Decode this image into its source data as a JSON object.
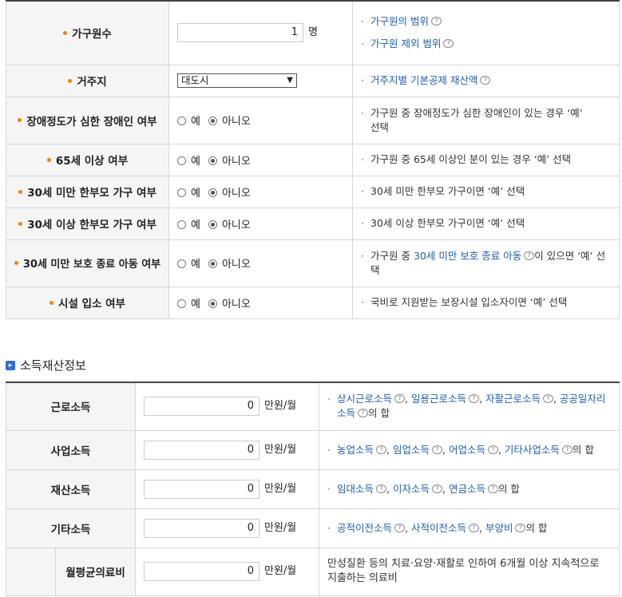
{
  "household": {
    "members": {
      "label": "가구원수",
      "value": "1",
      "unit": "명",
      "notes": [
        "가구원의 범위",
        "가구원 제외 범위"
      ]
    },
    "residence": {
      "label": "거주지",
      "value": "대도시",
      "note": "거주지별 기본공제 재산액"
    },
    "radio_yes": "예",
    "radio_no": "아니오",
    "disabled": {
      "label": "장애정도가 심한 장애인 여부",
      "note": "가구원 중 장애정도가 심한 장애인이 있는 경우 ‘예’ 선택"
    },
    "age65": {
      "label": "65세 이상 여부",
      "note": "가구원 중 65세 이상인 분이 있는 경우 ‘예’ 선택"
    },
    "single_under30": {
      "label": "30세 미만 한부모 가구 여부",
      "note": "30세 미만 한부모 가구이면 ‘예’ 선택"
    },
    "single_over30": {
      "label": "30세 이상 한부모 가구 여부",
      "note": "30세 이상 한부모 가구이면 ‘예’ 선택"
    },
    "care_end": {
      "label": "30세 미만 보호 종료 아동 여부",
      "note_pre": "가구원 중 ",
      "note_link": "30세 미만 보호 종료 아동",
      "note_post": "이 있으면 ‘예’ 선택"
    },
    "facility": {
      "label": "시설 입소 여부",
      "note": "국비로 지원받는 보장시설 입소자이면 ‘예’ 선택"
    }
  },
  "income": {
    "section_title": "소득재산정보",
    "unit": "만원/월",
    "earned": {
      "label": "근로소득",
      "value": "0",
      "links": [
        "상시근로소득",
        "일용근로소득",
        "자활근로소득",
        "공공일자리소득"
      ],
      "suffix": "의 합"
    },
    "business": {
      "label": "사업소득",
      "value": "0",
      "links": [
        "농업소득",
        "임업소득",
        "어업소득",
        "기타사업소득"
      ],
      "suffix": "의 합"
    },
    "property": {
      "label": "재산소득",
      "value": "0",
      "links": [
        "임대소득",
        "이자소득",
        "연금소득"
      ],
      "suffix": "의 합"
    },
    "other": {
      "label": "기타소득",
      "value": "0",
      "links": [
        "공적이전소득",
        "사적이전소득",
        "부양비"
      ],
      "suffix": "의 합"
    },
    "medical": {
      "label": "월평균의료비",
      "value": "0",
      "note": "만성질환 등의 치료·요양·재활로 인하여 6개월 이상 지속적으로 지출하는 의료비"
    }
  }
}
